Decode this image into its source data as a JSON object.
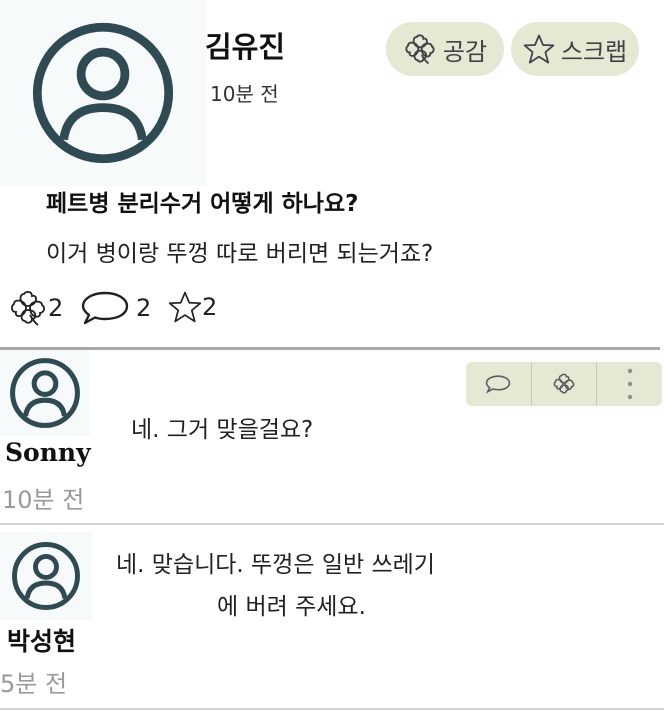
{
  "post": {
    "author": "김유진",
    "time": "10분 전",
    "title": "페트병 분리수거 어떻게 하나요?",
    "body": "이거 병이랑 뚜껑 따로 버리면 되는거죠?",
    "like_label": "공감",
    "scrap_label": "스크랩",
    "stats": {
      "likes": "2",
      "comments": "2",
      "scraps": "2"
    }
  },
  "comments": [
    {
      "author": "Sonny",
      "time": "10분 전",
      "text": "네. 그거 맞을걸요?"
    },
    {
      "author": "박성현",
      "time": "5분 전",
      "text_line1": "네. 맞습니다. 뚜껑은 일반 쓰레기",
      "text_line2": "에 버려 주세요."
    }
  ],
  "icons": {
    "avatar": "user-avatar-icon",
    "like": "clover-icon",
    "scrap": "star-icon",
    "comment": "speech-bubble-icon",
    "more": "vertical-dots-icon"
  },
  "colors": {
    "pill_bg": "#e3e9d3",
    "avatar_stroke": "#2f4a52",
    "muted_text": "#9a9a9a"
  }
}
